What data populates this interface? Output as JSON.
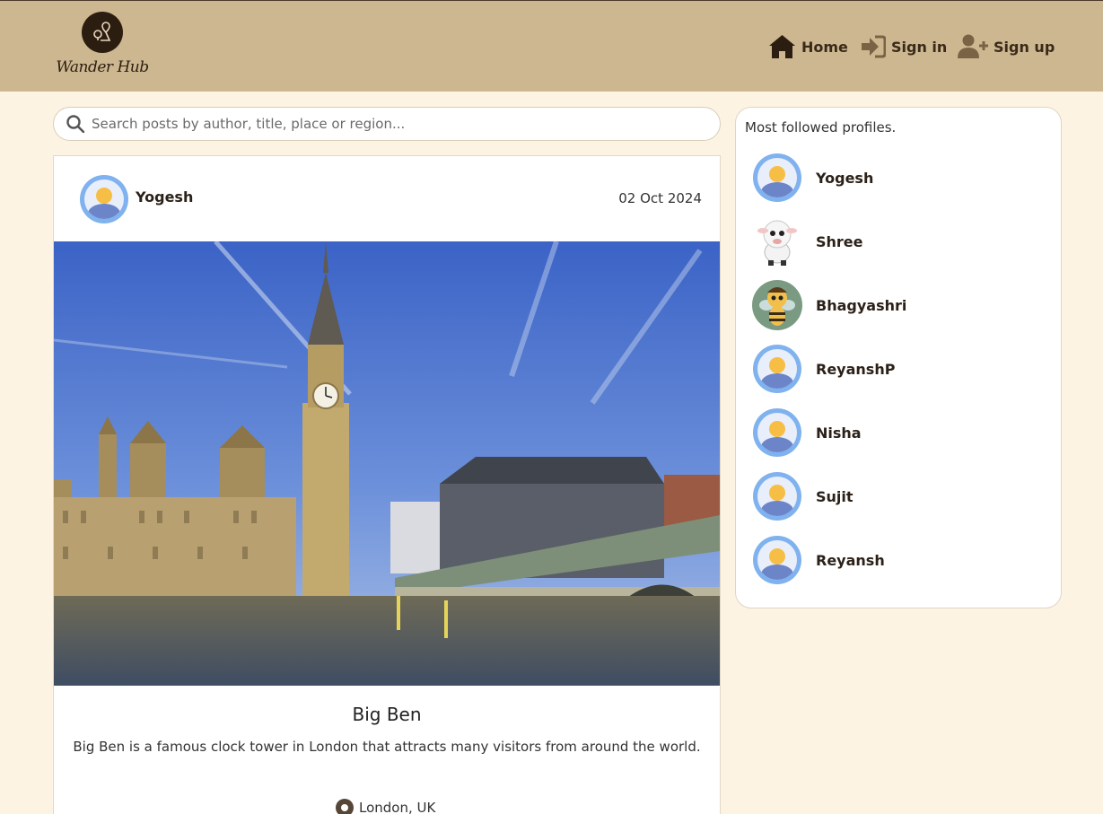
{
  "app": {
    "logo_text": "Wander Hub"
  },
  "nav": {
    "home_label": "Home",
    "signin_label": "Sign in",
    "signup_label": "Sign up"
  },
  "search": {
    "placeholder": "Search posts by author, title, place or region...",
    "value": ""
  },
  "post": {
    "author": "Yogesh",
    "date": "02 Oct 2024",
    "title": "Big Ben",
    "description": "Big Ben is a famous clock tower in London that attracts many visitors from around the world.",
    "location": "London, UK",
    "image": "big-ben-westminster-bridge-photo"
  },
  "sidebar": {
    "title": "Most followed profiles.",
    "profiles": [
      {
        "name": "Yogesh",
        "avatar": "default-avatar"
      },
      {
        "name": "Shree",
        "avatar": "sheep-cartoon-avatar"
      },
      {
        "name": "Bhagyashri",
        "avatar": "bee-cartoon-avatar"
      },
      {
        "name": "ReyanshP",
        "avatar": "default-avatar"
      },
      {
        "name": "Nisha",
        "avatar": "default-avatar"
      },
      {
        "name": "Sujit",
        "avatar": "default-avatar"
      },
      {
        "name": "Reyansh",
        "avatar": "default-avatar"
      }
    ]
  },
  "colors": {
    "header_bg": "#cdb790",
    "page_bg": "#fdf3e3",
    "nav_text": "#3a2a1a",
    "avatar_ring": "#7fb2ee",
    "avatar_sun": "#f7be45"
  }
}
